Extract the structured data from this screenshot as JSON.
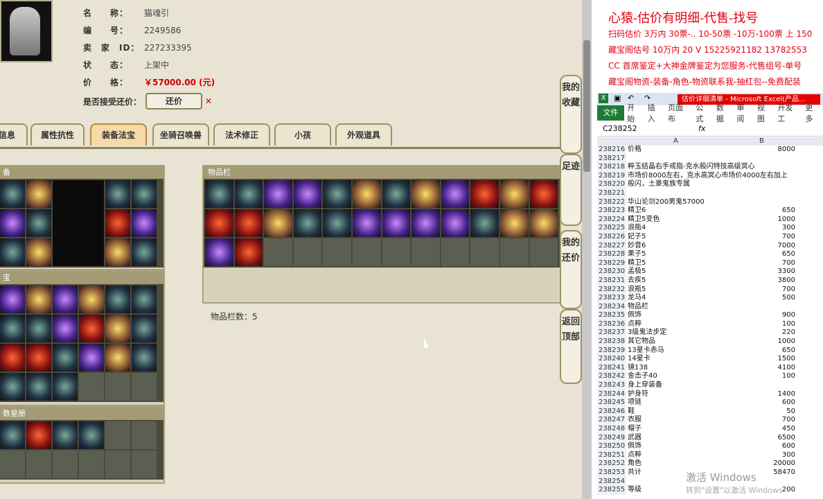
{
  "info": {
    "name_label": "名　　称：",
    "name_value": "猫魂引",
    "id_label": "编　　号：",
    "id_value": "2249586",
    "seller_label": "卖　家　ID：",
    "seller_value": "227233395",
    "status_label": "状　　态：",
    "status_value": "上架中",
    "price_label": "价　　格：",
    "price_value": "￥57000.00 (元)",
    "bargain_label": "是否接受还价：",
    "bargain_button": "还价"
  },
  "tabs": [
    "信息",
    "属性抗性",
    "装备法宝",
    "坐骑召唤兽",
    "法术修正",
    "小孩",
    "外观道具"
  ],
  "panels": {
    "equip_title": "备",
    "treasure_title": "宝",
    "card_title": "数星册",
    "bag_title": "物品栏",
    "bag_count": "物品栏数：5"
  },
  "side_buttons": [
    "我的收藏",
    "足迹",
    "我的还价",
    "返回顶部"
  ],
  "ad": {
    "title": "心猿-估价有明细-代售-找号",
    "line1": "扫码估价 3万内 30票-.. 10-50票 -10万-100票 上 150",
    "line2": "藏宝阁估号 10万内 20 V 15225921182 13782553",
    "line3": "CC 首席鉴定+大神金牌鉴定为您服务-代售组号-单号",
    "line4": "藏宝阁物资-装备-角色-物资联系我-抽红包--免费配装"
  },
  "excel": {
    "window_title": "估价详细清单 - Microsoft Excel(产品...",
    "ribbon": [
      "开始",
      "插入",
      "页面布",
      "公式",
      "数据",
      "审阅",
      "视图",
      "开发工",
      "更多"
    ],
    "file_tab": "文件",
    "name_box": "C238252",
    "fx": "fx",
    "col_a": "A",
    "col_b": "B",
    "rows": [
      [
        "238216",
        "价格",
        "8000"
      ],
      [
        "238217",
        "",
        ""
      ],
      [
        "238218",
        "粹玉结晶右手戒指-克水般闪特技高级冥心",
        ""
      ],
      [
        "238219",
        "市场价8000左右，克水高冥心市场价4000左右加上",
        ""
      ],
      [
        "238220",
        "般闪，土豪鬼族专属",
        ""
      ],
      [
        "238221",
        "",
        ""
      ],
      [
        "238222",
        "华山论剑200男鬼57000",
        ""
      ],
      [
        "238223",
        "精卫6",
        "650"
      ],
      [
        "238224",
        "精卫5变色",
        "1000"
      ],
      [
        "238225",
        "浪瓶4",
        "300"
      ],
      [
        "238226",
        "妃子5",
        "700"
      ],
      [
        "238227",
        "妙音6",
        "7000"
      ],
      [
        "238228",
        "果子5",
        "650"
      ],
      [
        "238229",
        "精卫5",
        "700"
      ],
      [
        "238230",
        "孟极5",
        "3300"
      ],
      [
        "238231",
        "去疾5",
        "3800"
      ],
      [
        "238232",
        "浪瓶5",
        "700"
      ],
      [
        "238233",
        "龙马4",
        "500"
      ],
      [
        "238234",
        "物品栏",
        ""
      ],
      [
        "238235",
        "佩饰",
        "900"
      ],
      [
        "238236",
        "点粹",
        "100"
      ],
      [
        "238237",
        "3级鬼法步定",
        "220"
      ],
      [
        "238238",
        "其它物品",
        "1000"
      ],
      [
        "238239",
        "13星卡赤马",
        "650"
      ],
      [
        "238240",
        "14星卡",
        "1500"
      ],
      [
        "238241",
        "镜138",
        "4100"
      ],
      [
        "238242",
        "金击子40",
        "100"
      ],
      [
        "238243",
        "身上穿装备",
        ""
      ],
      [
        "238244",
        "护身符",
        "1400"
      ],
      [
        "238245",
        "项链",
        "600"
      ],
      [
        "238246",
        "鞋",
        "50"
      ],
      [
        "238247",
        "衣服",
        "700"
      ],
      [
        "238248",
        "帽子",
        "450"
      ],
      [
        "238249",
        "武器",
        "6500"
      ],
      [
        "238250",
        "佩饰",
        "600"
      ],
      [
        "238251",
        "点粹",
        "300"
      ],
      [
        "238252",
        "角色",
        "20000"
      ],
      [
        "238253",
        "共计",
        "58470"
      ],
      [
        "238254",
        "",
        ""
      ],
      [
        "238255",
        "等级",
        "200"
      ]
    ]
  },
  "watermark": {
    "line1": "激活 Windows",
    "line2": "转到\"设置\"以激活 Windows"
  },
  "colors": {
    "accent": "#e60012",
    "excel_green": "#1d7b36",
    "panel_border": "#a9a07b"
  }
}
